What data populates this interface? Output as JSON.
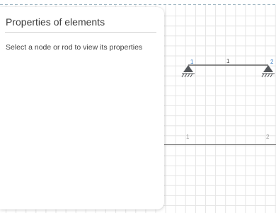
{
  "panel": {
    "title": "Properties of elements",
    "hint": "Select a node or rod to view its properties"
  },
  "model": {
    "nodes": [
      {
        "label": "1"
      },
      {
        "label": "2"
      }
    ],
    "rods": [
      {
        "label": "1"
      }
    ],
    "axis_ticks": [
      "1",
      "2"
    ]
  },
  "colors": {
    "grid": "#e6e6e6",
    "rod": "#666666",
    "support": "#55585c",
    "node_label": "#3d7fc5",
    "rod_label": "#444444",
    "tick_label": "#9a9a9a",
    "dashed_boundary": "#9fb6c2"
  }
}
